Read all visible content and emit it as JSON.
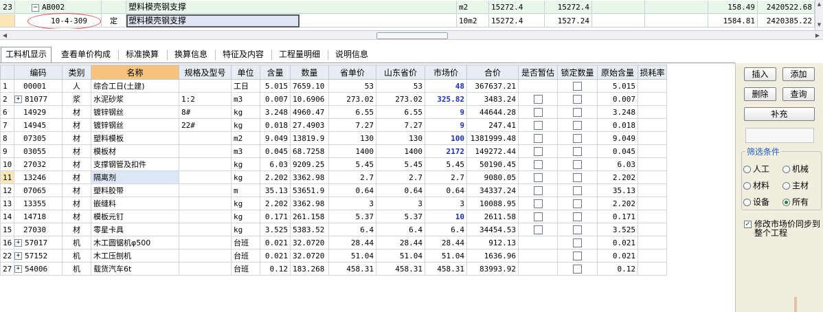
{
  "top_rows": [
    {
      "num": "23",
      "code": "AB002",
      "type": "",
      "name": "塑料模壳钢支撑",
      "unit": "m2",
      "qty": "15272.4",
      "qty2": "15272.4",
      "price": "158.49",
      "total": "2420522.68"
    },
    {
      "num": "",
      "code": "10-4-309",
      "type": "定",
      "name": "塑料模壳钢支撑",
      "unit": "10m2",
      "qty": "15272.4",
      "qty2": "1527.24",
      "price": "1584.81",
      "total": "2420385.22"
    }
  ],
  "tabs": [
    {
      "label": "工料机显示",
      "active": true
    },
    {
      "label": "查看单价构成",
      "active": false
    },
    {
      "label": "标准换算",
      "active": false
    },
    {
      "label": "换算信息",
      "active": false
    },
    {
      "label": "特征及内容",
      "active": false
    },
    {
      "label": "工程量明细",
      "active": false
    },
    {
      "label": "说明信息",
      "active": false
    }
  ],
  "table": {
    "headers": [
      "编码",
      "类别",
      "名称",
      "规格及型号",
      "单位",
      "含量",
      "数量",
      "省单价",
      "山东省价",
      "市场价",
      "合价",
      "是否暂估",
      "锁定数量",
      "原始含量",
      "损耗率"
    ],
    "rows": [
      {
        "n": "1",
        "exp": false,
        "code": "00001",
        "cat": "人",
        "name": "综合工日(土建)",
        "spec": "",
        "unit": "工日",
        "content": "5.015",
        "qty": "7659.10",
        "prov": "53",
        "sd": "53",
        "market": "48",
        "mblue": true,
        "total": "367637.21",
        "est": false,
        "lock": true,
        "orig": "5.015"
      },
      {
        "n": "2",
        "exp": true,
        "code": "81077",
        "cat": "浆",
        "name": "水泥砂浆",
        "spec": "1:2",
        "unit": "m3",
        "content": "0.007",
        "qty": "10.6906",
        "prov": "273.02",
        "sd": "273.02",
        "market": "325.82",
        "mblue": true,
        "total": "3483.24",
        "est": true,
        "lock": true,
        "orig": "0.007"
      },
      {
        "n": "6",
        "exp": false,
        "code": "14929",
        "cat": "材",
        "name": "镀锌钢丝",
        "spec": "8#",
        "unit": "kg",
        "content": "3.248",
        "qty": "4960.47",
        "prov": "6.55",
        "sd": "6.55",
        "market": "9",
        "mblue": true,
        "total": "44644.28",
        "est": true,
        "lock": true,
        "orig": "3.248"
      },
      {
        "n": "7",
        "exp": false,
        "code": "14945",
        "cat": "材",
        "name": "镀锌钢丝",
        "spec": "22#",
        "unit": "kg",
        "content": "0.018",
        "qty": "27.4903",
        "prov": "7.27",
        "sd": "7.27",
        "market": "9",
        "mblue": true,
        "total": "247.41",
        "est": true,
        "lock": true,
        "orig": "0.018"
      },
      {
        "n": "8",
        "exp": false,
        "code": "07305",
        "cat": "材",
        "name": "塑料模板",
        "spec": "",
        "unit": "m2",
        "content": "9.049",
        "qty": "13819.9",
        "prov": "130",
        "sd": "130",
        "market": "100",
        "mblue": true,
        "total": "1381999.48",
        "est": true,
        "lock": true,
        "orig": "9.049"
      },
      {
        "n": "9",
        "exp": false,
        "code": "03055",
        "cat": "材",
        "name": "模板材",
        "spec": "",
        "unit": "m3",
        "content": "0.045",
        "qty": "68.7258",
        "prov": "1400",
        "sd": "1400",
        "market": "2172",
        "mblue": true,
        "total": "149272.44",
        "est": true,
        "lock": true,
        "orig": "0.045"
      },
      {
        "n": "10",
        "exp": false,
        "code": "27032",
        "cat": "材",
        "name": "支撑钢管及扣件",
        "spec": "",
        "unit": "kg",
        "content": "6.03",
        "qty": "9209.25",
        "prov": "5.45",
        "sd": "5.45",
        "market": "5.45",
        "mblue": false,
        "total": "50190.45",
        "est": true,
        "lock": true,
        "orig": "6.03"
      },
      {
        "n": "11",
        "exp": false,
        "code": "13246",
        "cat": "材",
        "name": "隔离剂",
        "spec": "",
        "unit": "kg",
        "content": "2.202",
        "qty": "3362.98",
        "prov": "2.7",
        "sd": "2.7",
        "market": "2.7",
        "mblue": false,
        "total": "9080.05",
        "est": true,
        "lock": true,
        "orig": "2.202",
        "sel": true
      },
      {
        "n": "12",
        "exp": false,
        "code": "07065",
        "cat": "材",
        "name": "塑料胶带",
        "spec": "",
        "unit": "m",
        "content": "35.13",
        "qty": "53651.9",
        "prov": "0.64",
        "sd": "0.64",
        "market": "0.64",
        "mblue": false,
        "total": "34337.24",
        "est": true,
        "lock": true,
        "orig": "35.13"
      },
      {
        "n": "13",
        "exp": false,
        "code": "13355",
        "cat": "材",
        "name": "嵌缝料",
        "spec": "",
        "unit": "kg",
        "content": "2.202",
        "qty": "3362.98",
        "prov": "3",
        "sd": "3",
        "market": "3",
        "mblue": false,
        "total": "10088.95",
        "est": true,
        "lock": true,
        "orig": "2.202"
      },
      {
        "n": "14",
        "exp": false,
        "code": "14718",
        "cat": "材",
        "name": "模板元钉",
        "spec": "",
        "unit": "kg",
        "content": "0.171",
        "qty": "261.158",
        "prov": "5.37",
        "sd": "5.37",
        "market": "10",
        "mblue": true,
        "total": "2611.58",
        "est": true,
        "lock": true,
        "orig": "0.171"
      },
      {
        "n": "15",
        "exp": false,
        "code": "27030",
        "cat": "材",
        "name": "零星卡具",
        "spec": "",
        "unit": "kg",
        "content": "3.525",
        "qty": "5383.52",
        "prov": "6.4",
        "sd": "6.4",
        "market": "6.4",
        "mblue": false,
        "total": "34454.53",
        "est": true,
        "lock": true,
        "orig": "3.525"
      },
      {
        "n": "16",
        "exp": true,
        "code": "57017",
        "cat": "机",
        "name": "木工圆锯机φ500",
        "spec": "",
        "unit": "台班",
        "content": "0.021",
        "qty": "32.0720",
        "prov": "28.44",
        "sd": "28.44",
        "market": "28.44",
        "mblue": false,
        "total": "912.13",
        "est": false,
        "lock": true,
        "orig": "0.021"
      },
      {
        "n": "22",
        "exp": true,
        "code": "57152",
        "cat": "机",
        "name": "木工压刨机",
        "spec": "",
        "unit": "台班",
        "content": "0.021",
        "qty": "32.0720",
        "prov": "51.04",
        "sd": "51.04",
        "market": "51.04",
        "mblue": false,
        "total": "1636.96",
        "est": false,
        "lock": true,
        "orig": "0.021"
      },
      {
        "n": "27",
        "exp": true,
        "code": "54006",
        "cat": "机",
        "name": "载货汽车6t",
        "spec": "",
        "unit": "台班",
        "content": "0.12",
        "qty": "183.268",
        "prov": "458.31",
        "sd": "458.31",
        "market": "458.31",
        "mblue": false,
        "total": "83993.92",
        "est": false,
        "lock": true,
        "orig": "0.12"
      }
    ]
  },
  "panel": {
    "insert": "插入",
    "add": "添加",
    "delete": "删除",
    "query": "查询",
    "supplement": "补充",
    "filter_title": "筛选条件",
    "radios": [
      {
        "label": "人工",
        "checked": false
      },
      {
        "label": "机械",
        "checked": false
      },
      {
        "label": "材料",
        "checked": false
      },
      {
        "label": "主材",
        "checked": false
      },
      {
        "label": "设备",
        "checked": false
      },
      {
        "label": "所有",
        "checked": true
      }
    ],
    "sync_label": "修改市场价同步到整个工程",
    "sync_checked": true
  },
  "colors": {
    "market_blue": "#1b2fb4",
    "header_highlight": "#f6c47f",
    "circle_red": "#e04a4a"
  }
}
